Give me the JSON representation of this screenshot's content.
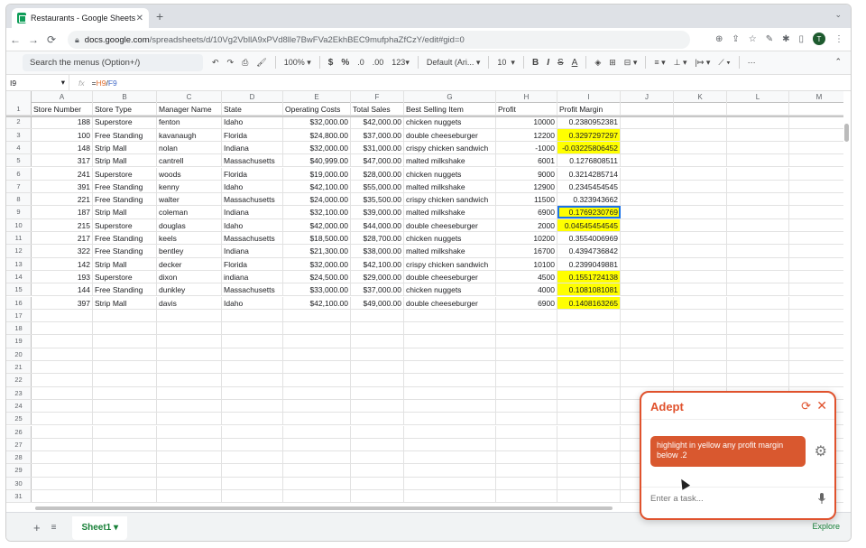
{
  "browser": {
    "tab_title": "Restaurants - Google Sheets",
    "url_host": "docs.google.com",
    "url_path": "/spreadsheets/d/10Vg2VbllA9xPVd8lle7BwFVa2EkhBEC9mufphaZfCzY/edit#gid=0",
    "avatar_letter": "T"
  },
  "toolbar": {
    "menu_search_placeholder": "Search the menus (Option+/)",
    "zoom": "100%",
    "currency": "$",
    "percent": "%",
    "dec_less": ".0",
    "dec_more": ".00",
    "number_format": "123",
    "font": "Default (Ari...",
    "font_size": "10",
    "bold": "B",
    "italic": "I",
    "strike": "S",
    "text_color": "A"
  },
  "formula_bar": {
    "cell_ref": "I9",
    "fx": "fx",
    "eq": "=",
    "ref1": "H9",
    "op": "/",
    "ref2": "F9"
  },
  "columns": [
    "A",
    "B",
    "C",
    "D",
    "E",
    "F",
    "G",
    "H",
    "I",
    "J",
    "K",
    "L",
    "M"
  ],
  "header_row": [
    "Store Number",
    "Store Type",
    "Manager Name",
    "State",
    "Operating Costs",
    "Total Sales",
    "Best Selling Item",
    "Profit",
    "Profit Margin"
  ],
  "rows": [
    [
      "188",
      "Superstore",
      "fenton",
      "Idaho",
      "$32,000.00",
      "$42,000.00",
      "chicken nuggets",
      "10000",
      "0.2380952381"
    ],
    [
      "100",
      "Free Standing",
      "kavanaugh",
      "Florida",
      "$24,800.00",
      "$37,000.00",
      "double cheeseburger",
      "12200",
      "0.3297297297"
    ],
    [
      "148",
      "Strip Mall",
      "nolan",
      "Indiana",
      "$32,000.00",
      "$31,000.00",
      "crispy chicken sandwich",
      "-1000",
      "-0.03225806452"
    ],
    [
      "317",
      "Strip Mall",
      "cantrell",
      "Massachusetts",
      "$40,999.00",
      "$47,000.00",
      "malted milkshake",
      "6001",
      "0.1276808511"
    ],
    [
      "241",
      "Superstore",
      "woods",
      "Florida",
      "$19,000.00",
      "$28,000.00",
      "chicken nuggets",
      "9000",
      "0.3214285714"
    ],
    [
      "391",
      "Free Standing",
      "kenny",
      "Idaho",
      "$42,100.00",
      "$55,000.00",
      "malted milkshake",
      "12900",
      "0.2345454545"
    ],
    [
      "221",
      "Free Standing",
      "walter",
      "Massachusetts",
      "$24,000.00",
      "$35,500.00",
      "crispy chicken sandwich",
      "11500",
      "0.323943662"
    ],
    [
      "187",
      "Strip Mall",
      "coleman",
      "Indiana",
      "$32,100.00",
      "$39,000.00",
      "malted milkshake",
      "6900",
      "0.1769230769"
    ],
    [
      "215",
      "Superstore",
      "douglas",
      "Idaho",
      "$42,000.00",
      "$44,000.00",
      "double cheeseburger",
      "2000",
      "0.04545454545"
    ],
    [
      "217",
      "Free Standing",
      "keels",
      "Massachusetts",
      "$18,500.00",
      "$28,700.00",
      "chicken nuggets",
      "10200",
      "0.3554006969"
    ],
    [
      "322",
      "Free Standing",
      "bentley",
      "Indiana",
      "$21,300.00",
      "$38,000.00",
      "malted milkshake",
      "16700",
      "0.4394736842"
    ],
    [
      "142",
      "Strip Mall",
      "decker",
      "Florida",
      "$32,000.00",
      "$42,100.00",
      "crispy chicken sandwich",
      "10100",
      "0.2399049881"
    ],
    [
      "193",
      "Superstore",
      "dixon",
      "indiana",
      "$24,500.00",
      "$29,000.00",
      "double cheeseburger",
      "4500",
      "0.1551724138"
    ],
    [
      "144",
      "Free Standing",
      "dunkley",
      "Massachusetts",
      "$33,000.00",
      "$37,000.00",
      "chicken nuggets",
      "4000",
      "0.1081081081"
    ],
    [
      "397",
      "Strip Mall",
      "davis",
      "Idaho",
      "$42,100.00",
      "$49,000.00",
      "double cheeseburger",
      "6900",
      "0.1408163265"
    ]
  ],
  "highlighted_rows": [
    3,
    4,
    9,
    10,
    14,
    15,
    16
  ],
  "selected_row": 9,
  "highlight_color": "#ffff00",
  "sheetbar": {
    "tab": "Sheet1",
    "explore": "Explore"
  },
  "adept": {
    "title": "Adept",
    "message": "highlight in yellow any profit margin below .2",
    "placeholder": "Enter a task...",
    "accent": "#e0522d"
  }
}
